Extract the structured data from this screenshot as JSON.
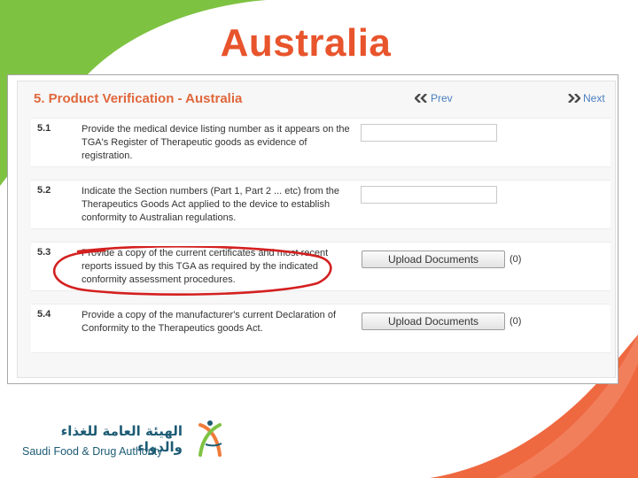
{
  "slide": {
    "title": "Australia"
  },
  "panel": {
    "heading": "5. Product Verification - Australia",
    "prev_label": "Prev",
    "next_label": "Next"
  },
  "rows": [
    {
      "number": "5.1",
      "text": "Provide the medical device listing number as it appears on the TGA's Register of Therapeutic goods as evidence of registration.",
      "control": "text-input",
      "value": ""
    },
    {
      "number": "5.2",
      "text": "Indicate the Section numbers (Part 1, Part 2 ... etc) from the Therapeutics Goods Act applied to the device to establish conformity to Australian regulations.",
      "control": "text-input",
      "value": ""
    },
    {
      "number": "5.3",
      "text": "Provide a copy of the current certificates and most recent reports issued by this TGA as required by the indicated conformity assessment procedures.",
      "control": "upload",
      "button_label": "Upload Documents",
      "count": "(0)"
    },
    {
      "number": "5.4",
      "text": "Provide a copy of the manufacturer's current Declaration of Conformity to the Therapeutics goods Act.",
      "control": "upload",
      "button_label": "Upload Documents",
      "count": "(0)"
    }
  ],
  "footer": {
    "logo_arabic": "الهيئة العامة للغذاء والدواء",
    "logo_english": "Saudi Food & Drug Authority"
  },
  "colors": {
    "title": "#e8542c",
    "heading": "#e0673c",
    "link": "#4a7fc0",
    "green_shape": "#7ec242",
    "orange_shape": "#ee6840",
    "annotation": "#d42020",
    "logo_text": "#1d5b74"
  },
  "icons": {
    "prev": "double-chevron-left-icon",
    "next": "double-chevron-right-icon"
  }
}
